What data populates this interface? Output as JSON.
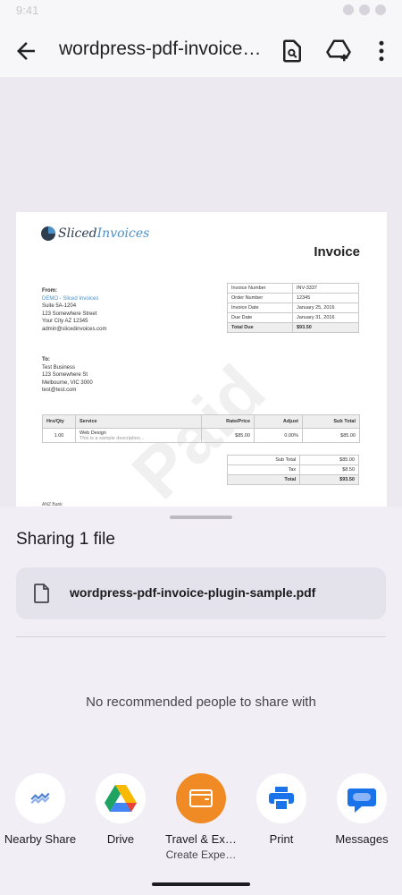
{
  "status": {
    "time": "9:41"
  },
  "app_bar": {
    "title": "wordpress-pdf-invoice-…"
  },
  "invoice": {
    "logo_text_a": "Sliced",
    "logo_text_b": "Invoices",
    "heading": "Invoice",
    "from_label": "From:",
    "from_lines": [
      "DEMO - Sliced Invoices",
      "Suite 5A-1204",
      "123 Somewhere Street",
      "Your City AZ 12345",
      "admin@slicedinvoices.com"
    ],
    "to_label": "To:",
    "to_lines": [
      "Test Business",
      "123 Somewhere St",
      "Melbourne, VIC 3000",
      "test@test.com"
    ],
    "meta": [
      {
        "k": "Invoice Number",
        "v": "INV-3337"
      },
      {
        "k": "Order Number",
        "v": "12345"
      },
      {
        "k": "Invoice Date",
        "v": "January 25, 2016"
      },
      {
        "k": "Due Date",
        "v": "January 31, 2016"
      },
      {
        "k": "Total Due",
        "v": "$93.50"
      }
    ],
    "item_headers": [
      "Hrs/Qty",
      "Service",
      "Rate/Price",
      "Adjust",
      "Sub Total"
    ],
    "item": {
      "qty": "1.00",
      "service": "Web Design",
      "desc": "This is a sample description...",
      "rate": "$85.00",
      "adjust": "0.00%",
      "subtotal": "$85.00"
    },
    "totals": [
      {
        "k": "Sub Total",
        "v": "$85.00"
      },
      {
        "k": "Tax",
        "v": "$8.50"
      },
      {
        "k": "Total",
        "v": "$93.50"
      }
    ],
    "watermark": "Paid",
    "footer_snip": "ANZ Bank"
  },
  "sheet": {
    "title": "Sharing 1 file",
    "file_name": "wordpress-pdf-invoice-plugin-sample.pdf",
    "no_recommendations": "No recommended people to share with",
    "targets": [
      {
        "label": "Nearby Share",
        "sub": "",
        "icon": "nearby-share-icon"
      },
      {
        "label": "Drive",
        "sub": "",
        "icon": "drive-icon"
      },
      {
        "label": "Travel & Ex…",
        "sub": "Create Expe…",
        "icon": "travel-expense-icon"
      },
      {
        "label": "Print",
        "sub": "",
        "icon": "print-icon"
      },
      {
        "label": "Messages",
        "sub": "",
        "icon": "messages-icon"
      }
    ]
  },
  "colors": {
    "accent_orange": "#f08a24",
    "drive_green": "#1ea362",
    "messages_blue": "#1a73e8"
  }
}
